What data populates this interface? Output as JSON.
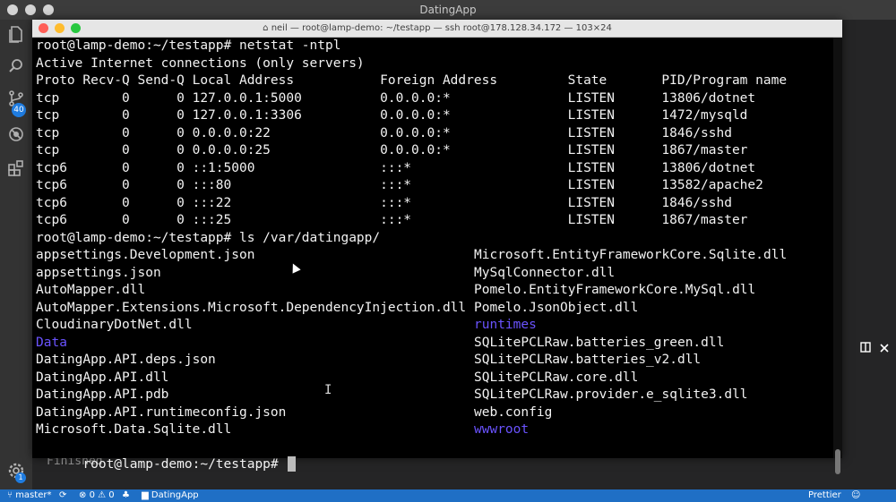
{
  "app": {
    "window_title": "DatingApp"
  },
  "activity": {
    "scm_badge": "40",
    "settings_badge": "1"
  },
  "panel": {
    "finished_text": "Finished"
  },
  "terminal": {
    "title": "neil — root@lamp-demo: ~/testapp — ssh root@178.128.34.172 — 103×24",
    "lines": [
      "root@lamp-demo:~/testapp# netstat -ntpl",
      "Active Internet connections (only servers)",
      "Proto Recv-Q Send-Q Local Address           Foreign Address         State       PID/Program name",
      "tcp        0      0 127.0.0.1:5000          0.0.0.0:*               LISTEN      13806/dotnet",
      "tcp        0      0 127.0.0.1:3306          0.0.0.0:*               LISTEN      1472/mysqld",
      "tcp        0      0 0.0.0.0:22              0.0.0.0:*               LISTEN      1846/sshd",
      "tcp        0      0 0.0.0.0:25              0.0.0.0:*               LISTEN      1867/master",
      "tcp6       0      0 ::1:5000                :::*                    LISTEN      13806/dotnet",
      "tcp6       0      0 :::80                   :::*                    LISTEN      13582/apache2",
      "tcp6       0      0 :::22                   :::*                    LISTEN      1846/sshd",
      "tcp6       0      0 :::25                   :::*                    LISTEN      1867/master",
      "root@lamp-demo:~/testapp# ls /var/datingapp/"
    ],
    "ls_left": [
      {
        "name": "appsettings.Development.json",
        "dir": false
      },
      {
        "name": "appsettings.json",
        "dir": false
      },
      {
        "name": "AutoMapper.dll",
        "dir": false
      },
      {
        "name": "AutoMapper.Extensions.Microsoft.DependencyInjection.dll",
        "dir": false
      },
      {
        "name": "CloudinaryDotNet.dll",
        "dir": false
      },
      {
        "name": "Data",
        "dir": true
      },
      {
        "name": "DatingApp.API.deps.json",
        "dir": false
      },
      {
        "name": "DatingApp.API.dll",
        "dir": false
      },
      {
        "name": "DatingApp.API.pdb",
        "dir": false
      },
      {
        "name": "DatingApp.API.runtimeconfig.json",
        "dir": false
      },
      {
        "name": "Microsoft.Data.Sqlite.dll",
        "dir": false
      }
    ],
    "ls_right": [
      {
        "name": "Microsoft.EntityFrameworkCore.Sqlite.dll",
        "dir": false
      },
      {
        "name": "MySqlConnector.dll",
        "dir": false
      },
      {
        "name": "Pomelo.EntityFrameworkCore.MySql.dll",
        "dir": false
      },
      {
        "name": "Pomelo.JsonObject.dll",
        "dir": false
      },
      {
        "name": "runtimes",
        "dir": true
      },
      {
        "name": "SQLitePCLRaw.batteries_green.dll",
        "dir": false
      },
      {
        "name": "SQLitePCLRaw.batteries_v2.dll",
        "dir": false
      },
      {
        "name": "SQLitePCLRaw.core.dll",
        "dir": false
      },
      {
        "name": "SQLitePCLRaw.provider.e_sqlite3.dll",
        "dir": false
      },
      {
        "name": "web.config",
        "dir": false
      },
      {
        "name": "wwwroot",
        "dir": true
      }
    ],
    "prompt": "root@lamp-demo:~/testapp#",
    "dir_color": "#6a53ff"
  },
  "statusbar": {
    "branch": "master*",
    "errors": "0",
    "warnings": "0",
    "folder": "DatingApp",
    "formatter": "Prettier"
  },
  "colors": {
    "statusbar_bg": "#1f6fc5",
    "terminal_bg": "#000000",
    "traffic_red": "#ff5f57",
    "traffic_yellow": "#febc2e",
    "traffic_green": "#28c840"
  }
}
